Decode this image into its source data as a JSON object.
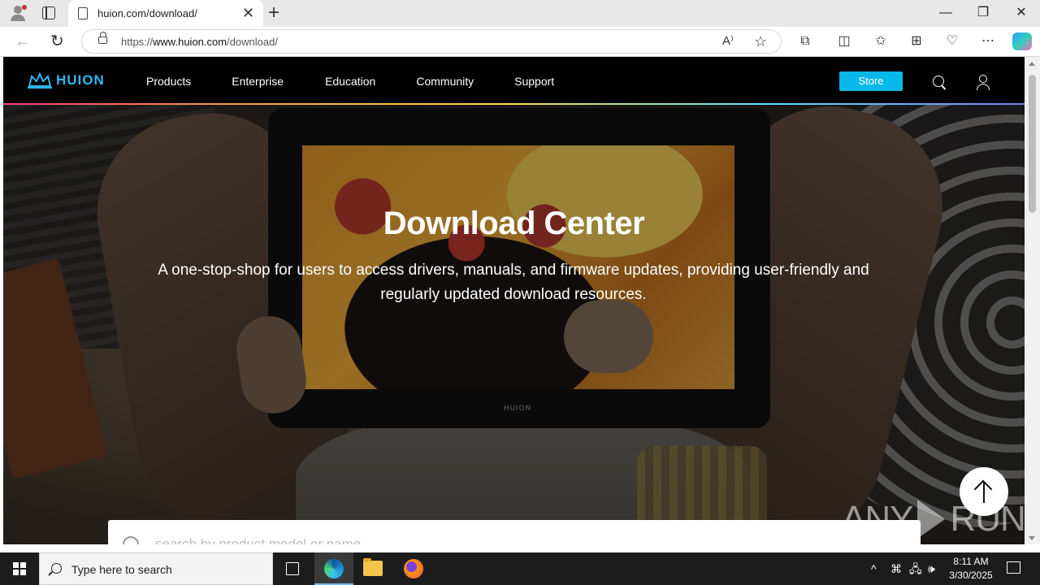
{
  "browser": {
    "tab_title": "huion.com/download/",
    "tab_close": "✕",
    "new_tab": "+",
    "url_prefix": "https://",
    "url_domain": "www.huion.com",
    "url_path": "/download/",
    "window_controls": {
      "minimize": "—",
      "restore": "❐",
      "close": "✕"
    },
    "nav": {
      "back": "←",
      "refresh": "↻"
    },
    "address_icons": {
      "read_aloud": "A⁾",
      "favorite": "☆"
    },
    "toolbar_icons": {
      "extensions": "⧉",
      "split": "◫",
      "favorites": "✩",
      "collections": "⊞",
      "performance": "♡",
      "more": "⋯"
    }
  },
  "site": {
    "logo_text": "HUION",
    "menu": [
      "Products",
      "Enterprise",
      "Education",
      "Community",
      "Support"
    ],
    "store_label": "Store",
    "accent": "#08b8e8"
  },
  "hero": {
    "title": "Download Center",
    "subtitle": "A one-stop-shop for users to access drivers, manuals, and firmware updates, providing user-friendly and regularly updated download resources.",
    "tablet_brand": "HUION"
  },
  "search": {
    "placeholder": "search by product model or name"
  },
  "watermark": {
    "left": "ANY",
    "right": "RUN"
  },
  "taskbar": {
    "search_placeholder": "Type here to search",
    "tray_icons": {
      "chevron": "^",
      "meet": "⌘",
      "network": "🖧",
      "volume": "🕪"
    },
    "time": "8:11 AM",
    "date": "3/30/2025"
  }
}
